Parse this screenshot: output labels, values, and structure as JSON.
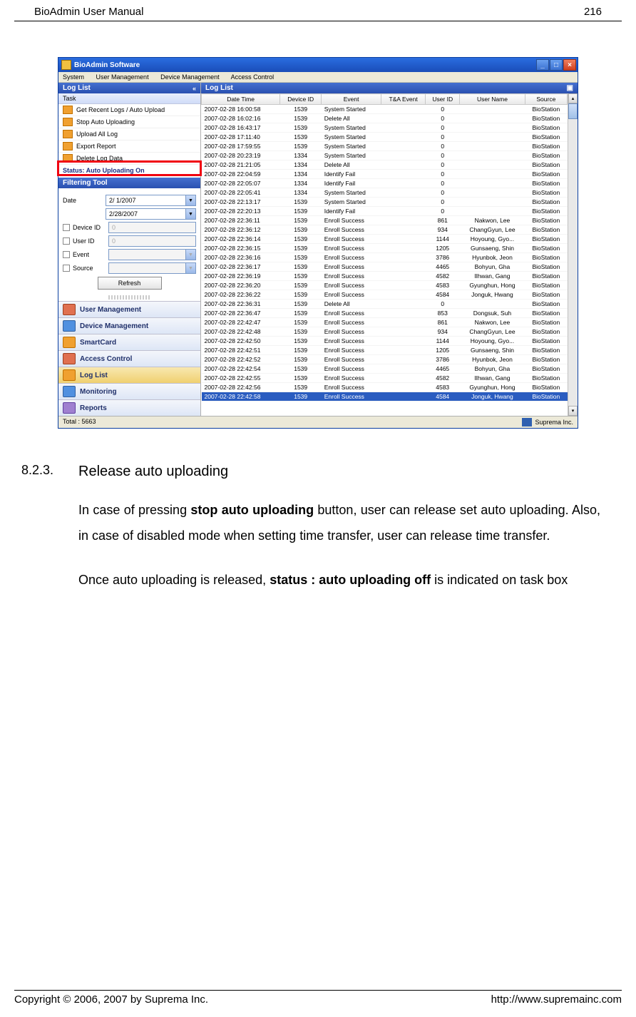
{
  "header": {
    "left": "BioAdmin User Manual",
    "right": "216"
  },
  "footer": {
    "left": "Copyright © 2006, 2007 by Suprema Inc.",
    "right": "http://www.supremainc.com"
  },
  "section": {
    "num": "8.2.3.",
    "title": "Release auto uploading",
    "p1a": "In case of pressing ",
    "p1b": "stop auto uploading",
    "p1c": " button, user can release set auto uploading. Also, in case of disabled mode when setting time transfer, user can release time transfer.",
    "p2a": "Once auto uploading is released, ",
    "p2b": "status : auto uploading off",
    "p2c": " is indicated on task box"
  },
  "win": {
    "title": "BioAdmin Software",
    "menu": [
      "System",
      "User Management",
      "Device Management",
      "Access Control"
    ],
    "left_header": "Log List",
    "task_label": "Task",
    "tasks": [
      "Get Recent Logs / Auto Upload",
      "Stop Auto Uploading",
      "Upload All Log",
      "Export Report",
      "Delete Log Data"
    ],
    "status": "Status: Auto Uploading On",
    "filter_label": "Filtering Tool",
    "filter": {
      "date_label": "Date",
      "date_from": "2/ 1/2007",
      "date_to": "2/28/2007",
      "device_label": "Device ID",
      "device_val": "0",
      "user_label": "User ID",
      "user_val": "0",
      "event_label": "Event",
      "source_label": "Source",
      "refresh": "Refresh"
    },
    "nav": [
      "User Management",
      "Device Management",
      "SmartCard",
      "Access Control",
      "Log List",
      "Monitoring",
      "Reports"
    ],
    "right_header": "Log List",
    "cols": [
      "Date Time",
      "Device ID",
      "Event",
      "T&A Event",
      "User ID",
      "User Name",
      "Source"
    ],
    "rows": [
      [
        "2007-02-28 16:00:58",
        "1539",
        "System Started",
        "",
        "0",
        "",
        "BioStation"
      ],
      [
        "2007-02-28 16:02:16",
        "1539",
        "Delete All",
        "",
        "0",
        "",
        "BioStation"
      ],
      [
        "2007-02-28 16:43:17",
        "1539",
        "System Started",
        "",
        "0",
        "",
        "BioStation"
      ],
      [
        "2007-02-28 17:11:40",
        "1539",
        "System Started",
        "",
        "0",
        "",
        "BioStation"
      ],
      [
        "2007-02-28 17:59:55",
        "1539",
        "System Started",
        "",
        "0",
        "",
        "BioStation"
      ],
      [
        "2007-02-28 20:23:19",
        "1334",
        "System Started",
        "",
        "0",
        "",
        "BioStation"
      ],
      [
        "2007-02-28 21:21:05",
        "1334",
        "Delete All",
        "",
        "0",
        "",
        "BioStation"
      ],
      [
        "2007-02-28 22:04:59",
        "1334",
        "Identify Fail",
        "",
        "0",
        "",
        "BioStation"
      ],
      [
        "2007-02-28 22:05:07",
        "1334",
        "Identify Fail",
        "",
        "0",
        "",
        "BioStation"
      ],
      [
        "2007-02-28 22:05:41",
        "1334",
        "System Started",
        "",
        "0",
        "",
        "BioStation"
      ],
      [
        "2007-02-28 22:13:17",
        "1539",
        "System Started",
        "",
        "0",
        "",
        "BioStation"
      ],
      [
        "2007-02-28 22:20:13",
        "1539",
        "Identify Fail",
        "",
        "0",
        "",
        "BioStation"
      ],
      [
        "2007-02-28 22:36:11",
        "1539",
        "Enroll Success",
        "",
        "861",
        "Nakwon, Lee",
        "BioStation"
      ],
      [
        "2007-02-28 22:36:12",
        "1539",
        "Enroll Success",
        "",
        "934",
        "ChangGyun, Lee",
        "BioStation"
      ],
      [
        "2007-02-28 22:36:14",
        "1539",
        "Enroll Success",
        "",
        "1144",
        "Hoyoung, Gyo...",
        "BioStation"
      ],
      [
        "2007-02-28 22:36:15",
        "1539",
        "Enroll Success",
        "",
        "1205",
        "Gunsaeng, Shin",
        "BioStation"
      ],
      [
        "2007-02-28 22:36:16",
        "1539",
        "Enroll Success",
        "",
        "3786",
        "Hyunbok, Jeon",
        "BioStation"
      ],
      [
        "2007-02-28 22:36:17",
        "1539",
        "Enroll Success",
        "",
        "4465",
        "Bohyun, Gha",
        "BioStation"
      ],
      [
        "2007-02-28 22:36:19",
        "1539",
        "Enroll Success",
        "",
        "4582",
        "Ilhwan, Gang",
        "BioStation"
      ],
      [
        "2007-02-28 22:36:20",
        "1539",
        "Enroll Success",
        "",
        "4583",
        "Gyunghun, Hong",
        "BioStation"
      ],
      [
        "2007-02-28 22:36:22",
        "1539",
        "Enroll Success",
        "",
        "4584",
        "Jonguk, Hwang",
        "BioStation"
      ],
      [
        "2007-02-28 22:36:31",
        "1539",
        "Delete All",
        "",
        "0",
        "",
        "BioStation"
      ],
      [
        "2007-02-28 22:36:47",
        "1539",
        "Enroll Success",
        "",
        "853",
        "Dongsuk, Suh",
        "BioStation"
      ],
      [
        "2007-02-28 22:42:47",
        "1539",
        "Enroll Success",
        "",
        "861",
        "Nakwon, Lee",
        "BioStation"
      ],
      [
        "2007-02-28 22:42:48",
        "1539",
        "Enroll Success",
        "",
        "934",
        "ChangGyun, Lee",
        "BioStation"
      ],
      [
        "2007-02-28 22:42:50",
        "1539",
        "Enroll Success",
        "",
        "1144",
        "Hoyoung, Gyo...",
        "BioStation"
      ],
      [
        "2007-02-28 22:42:51",
        "1539",
        "Enroll Success",
        "",
        "1205",
        "Gunsaeng, Shin",
        "BioStation"
      ],
      [
        "2007-02-28 22:42:52",
        "1539",
        "Enroll Success",
        "",
        "3786",
        "Hyunbok, Jeon",
        "BioStation"
      ],
      [
        "2007-02-28 22:42:54",
        "1539",
        "Enroll Success",
        "",
        "4465",
        "Bohyun, Gha",
        "BioStation"
      ],
      [
        "2007-02-28 22:42:55",
        "1539",
        "Enroll Success",
        "",
        "4582",
        "Ilhwan, Gang",
        "BioStation"
      ],
      [
        "2007-02-28 22:42:56",
        "1539",
        "Enroll Success",
        "",
        "4583",
        "Gyunghun, Hong",
        "BioStation"
      ],
      [
        "2007-02-28 22:42:58",
        "1539",
        "Enroll Success",
        "",
        "4584",
        "Jonguk, Hwang",
        "BioStation"
      ]
    ],
    "statusbar": {
      "left": "Total : 5663",
      "right": "Suprema Inc."
    }
  }
}
